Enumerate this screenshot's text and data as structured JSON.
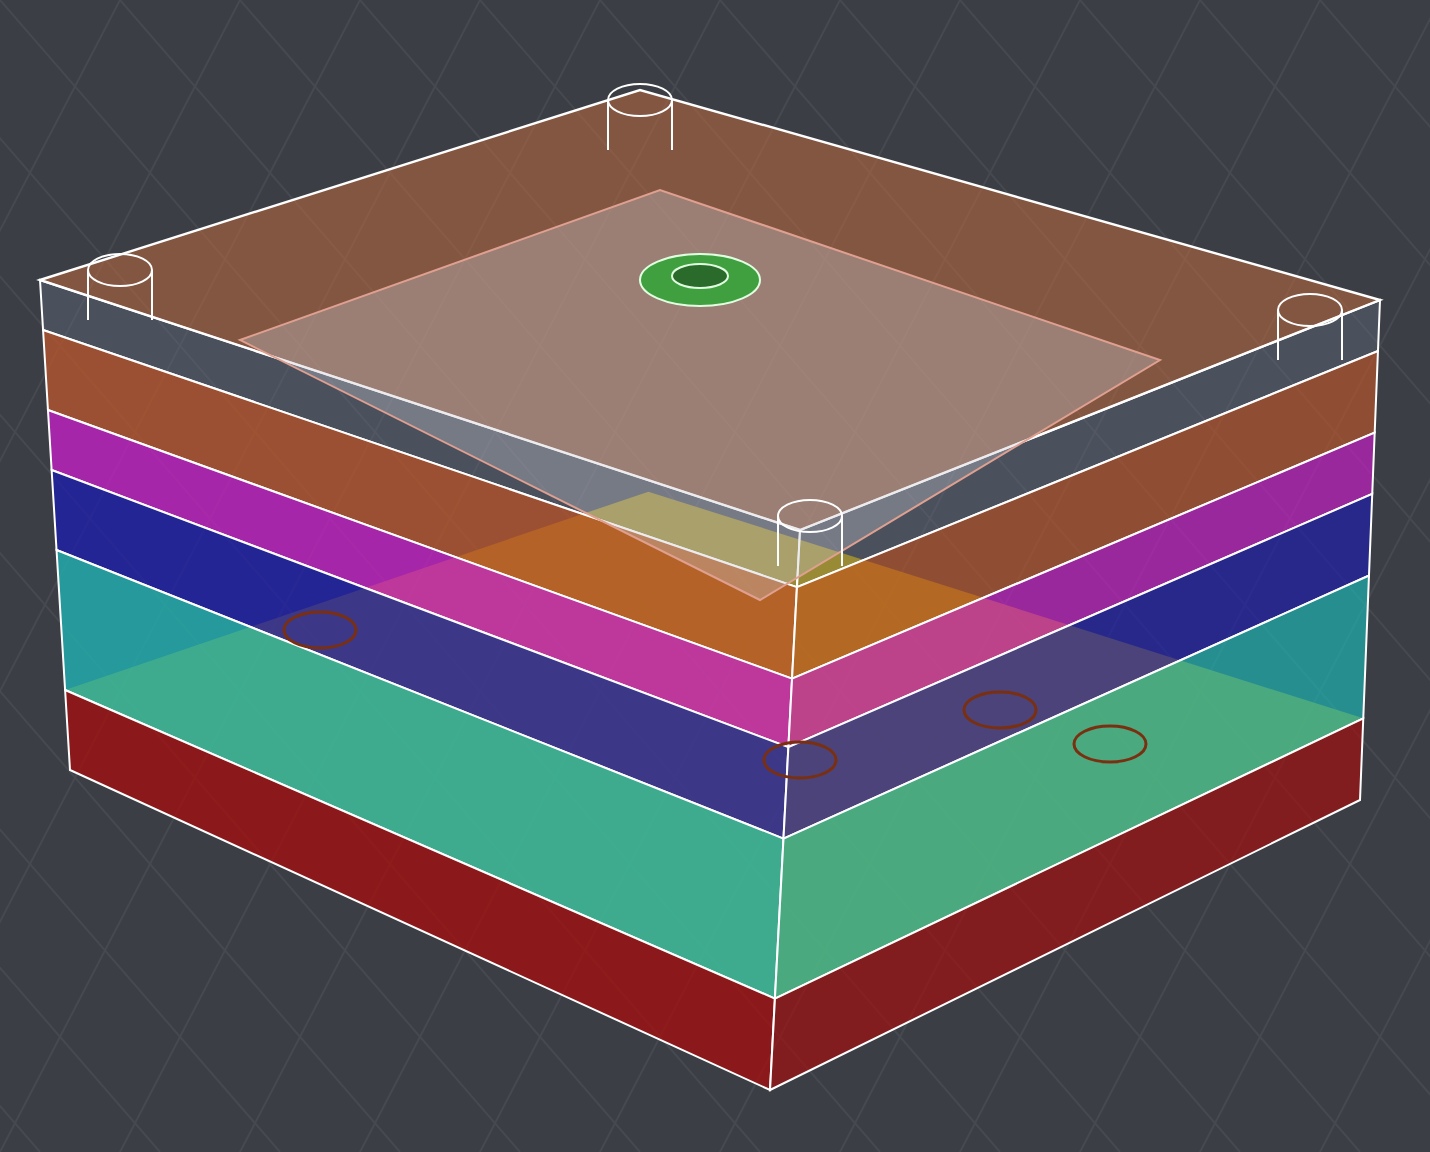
{
  "viewport": {
    "kind": "wireframe-3d",
    "grid": true
  }
}
